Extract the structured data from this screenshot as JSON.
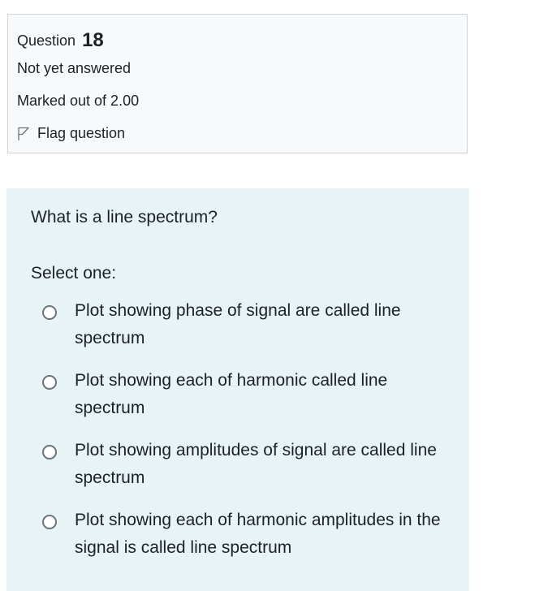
{
  "info": {
    "question_label": "Question",
    "question_number": "18",
    "state": "Not yet answered",
    "grade": "Marked out of 2.00",
    "flag_label": "Flag question"
  },
  "question": {
    "text": "What is a line spectrum?",
    "prompt": "Select one:",
    "options": [
      {
        "label": "Plot showing phase of signal are called line spectrum",
        "selected": false
      },
      {
        "label": "Plot showing each of harmonic called line spectrum",
        "selected": false
      },
      {
        "label": "Plot showing amplitudes of signal are called line spectrum",
        "selected": false
      },
      {
        "label": "Plot showing each of harmonic amplitudes in the signal is called line spectrum",
        "selected": false
      }
    ]
  },
  "colors": {
    "info_background": "#f8f9fa",
    "info_border": "#cfd4d9",
    "content_background": "#e7f3f5",
    "text": "#1d2125"
  },
  "icons": {
    "flag": "flag-icon"
  }
}
